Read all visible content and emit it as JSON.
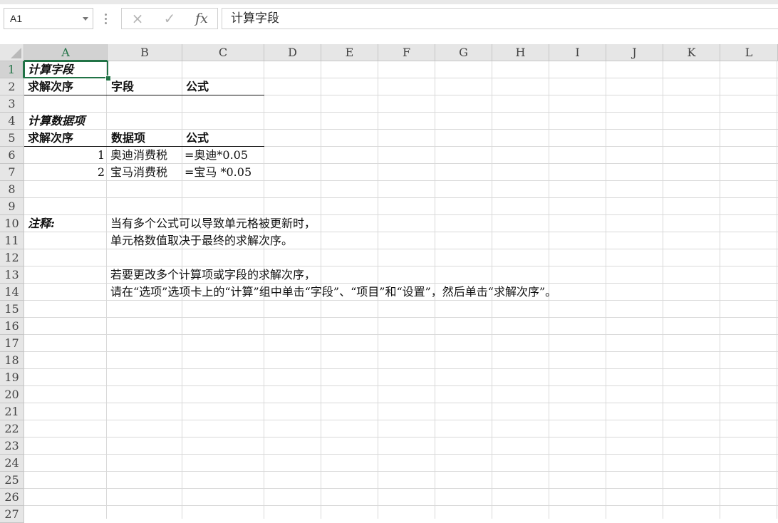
{
  "namebox": {
    "value": "A1"
  },
  "formula_bar": {
    "cancel_icon": "×",
    "enter_icon": "✓",
    "fx_label": "fx",
    "value": "计算字段"
  },
  "columns": [
    "A",
    "B",
    "C",
    "D",
    "E",
    "F",
    "G",
    "H",
    "I",
    "J",
    "K",
    "L"
  ],
  "rows": [
    "1",
    "2",
    "3",
    "4",
    "5",
    "6",
    "7",
    "8",
    "9",
    "10",
    "11",
    "12",
    "13",
    "14",
    "15",
    "16",
    "17",
    "18",
    "19",
    "20",
    "21",
    "22",
    "23",
    "24",
    "25",
    "26",
    "27"
  ],
  "cells": {
    "a1": "计算字段",
    "a2": "求解次序",
    "b2": "字段",
    "c2": "公式",
    "a4": "计算数据项",
    "a5": "求解次序",
    "b5": "数据项",
    "c5": "公式",
    "a6": "1",
    "b6": "奥迪消费税",
    "c6": "=奥迪*0.05",
    "a7": "2",
    "b7": "宝马消费税",
    "c7": "=宝马 *0.05",
    "a10": "注释:",
    "b10": "当有多个公式可以导致单元格被更新时，",
    "b11": "单元格数值取决于最终的求解次序。",
    "b13": "若要更改多个计算项或字段的求解次序，",
    "b14": "请在“选项”选项卡上的“计算”组中单击“字段”、“项目”和“设置”，然后单击“求解次序”。"
  },
  "selection": {
    "cell": "A1",
    "accent_color": "#217346"
  }
}
